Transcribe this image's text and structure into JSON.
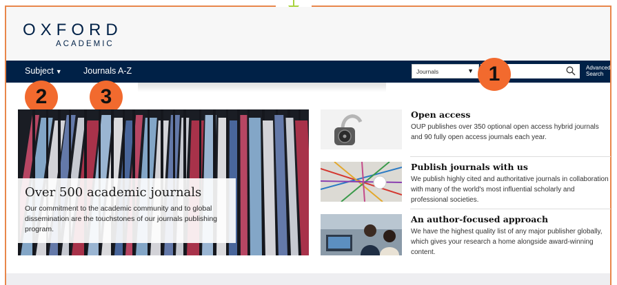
{
  "logo": {
    "top": "OXFORD",
    "sub": "ACADEMIC"
  },
  "nav": {
    "subject_label": "Subject",
    "subject_caret": "▼",
    "journals_az_label": "Journals A-Z"
  },
  "search": {
    "select_value": "Journals",
    "select_caret": "▼",
    "input_value": "",
    "advanced_line1": "Advanced",
    "advanced_line2": "Search"
  },
  "badges": [
    "1",
    "2",
    "3"
  ],
  "hero": {
    "title": "Over 500 academic journals",
    "text": "Our commitment to the academic community and to global dissemination are the touchstones of our journals publishing program."
  },
  "features": [
    {
      "title": "Open access",
      "text": "OUP publishes over 350 optional open access hybrid journals and 90 fully open access journals each year.",
      "icon": "padlock-image"
    },
    {
      "title": "Publish journals with us",
      "text": "We publish highly cited and authoritative journals in collaboration with many of the world's most influential scholarly and professional societies.",
      "icon": "network-strings-image"
    },
    {
      "title": "An author-focused approach",
      "text": "We have the highest quality list of any major publisher globally, which gives your research a home alongside award-winning content.",
      "icon": "researchers-image"
    }
  ],
  "colors": {
    "navy": "#002147",
    "badge": "#f26a2e",
    "frame": "#e8864a",
    "arrow": "#a8d33c"
  }
}
